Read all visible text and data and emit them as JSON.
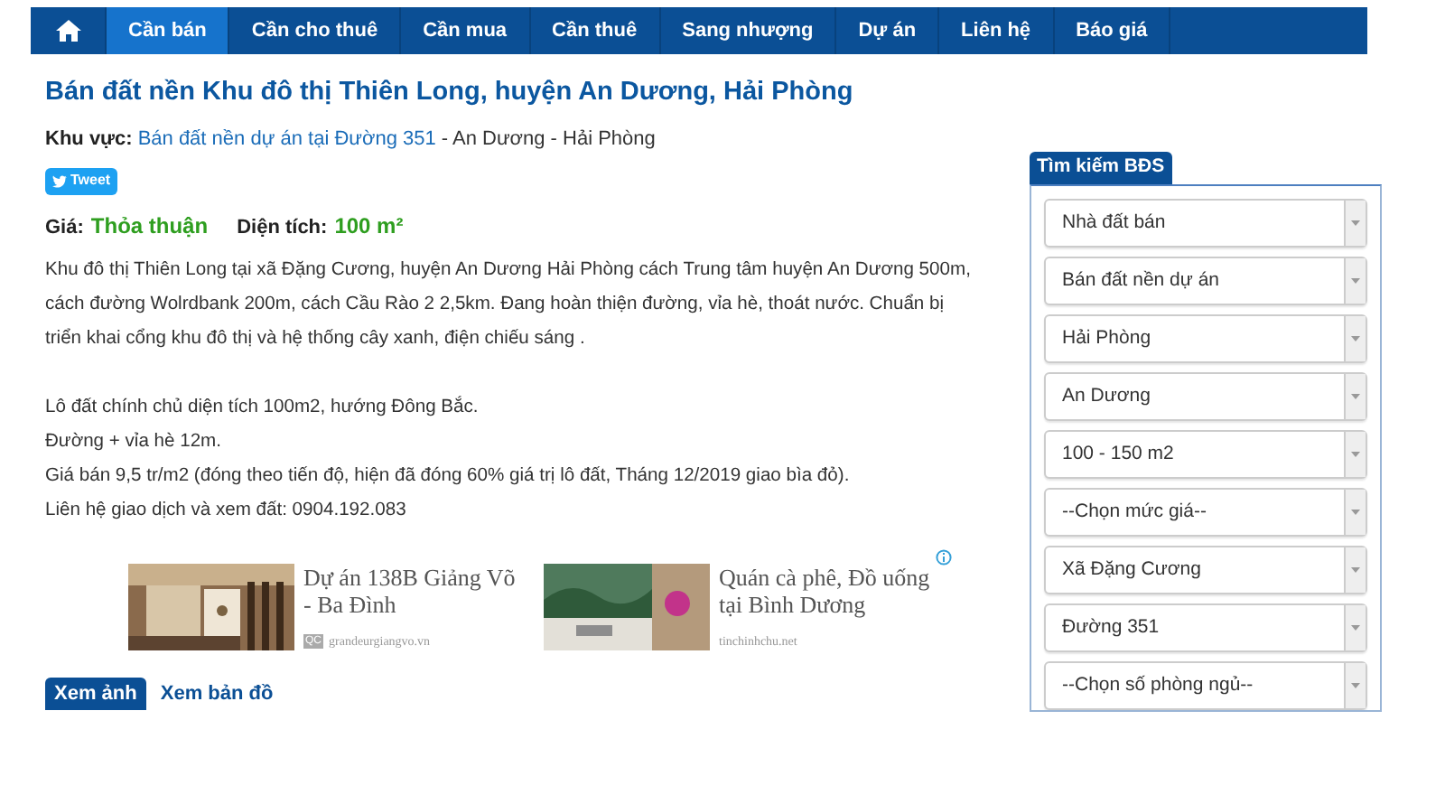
{
  "nav": [
    {
      "kind": "home",
      "selected": false
    },
    {
      "kind": "link",
      "label": "Cần bán",
      "selected": true
    },
    {
      "kind": "link",
      "label": "Cần cho thuê",
      "selected": false
    },
    {
      "kind": "link",
      "label": "Cần mua",
      "selected": false
    },
    {
      "kind": "link",
      "label": "Cần thuê",
      "selected": false
    },
    {
      "kind": "link",
      "label": "Sang nhượng",
      "selected": false
    },
    {
      "kind": "link",
      "label": "Dự án",
      "selected": false
    },
    {
      "kind": "link",
      "label": "Liên hệ",
      "selected": false
    },
    {
      "kind": "link",
      "label": "Báo giá",
      "selected": false
    }
  ],
  "title": "Bán đất nền Khu đô thị Thiên Long, huyện An Dương, Hải Phòng",
  "area": {
    "label": "Khu vực:",
    "link": "Bán đất nền dự án tại Đường 351",
    "rest": "- An Dương - Hải Phòng"
  },
  "tweet_button": "Tweet",
  "price": {
    "label": "Giá:",
    "value": "Thỏa thuận"
  },
  "size": {
    "label": "Diện tích:",
    "value": "100 m²"
  },
  "description": [
    [
      "Khu đô thị Thiên Long tại xã Đặng Cương, huyện An Dương Hải Phòng cách Trung tâm huyện An Dương 500m, cách đường Wolrdbank 200m, cách Cầu Rào 2 2,5km. Đang hoàn thiện đường, vỉa hè, thoát nước. Chuẩn bị triển khai cổng khu đô thị và hệ thống cây xanh, điện chiếu sáng ."
    ],
    [
      "Lô đất chính chủ diện tích 100m2, hướng Đông Bắc.",
      "Đường + vỉa hè 12m.",
      "Giá bán 9,5 tr/m2 (đóng theo tiến độ, hiện đã đóng 60% giá trị lô đất, Tháng 12/2019 giao bìa đỏ).",
      "Liên hệ giao dịch và xem đất: 0904.192.083"
    ]
  ],
  "ads": [
    {
      "title": "Dự án 138B Giảng Võ - Ba Đình",
      "badge": "QC",
      "source": "grandeurgiangvo.vn",
      "kind": "interior"
    },
    {
      "title": "Quán cà phê, Đồ uống tại Bình Dương",
      "source": "tinchinhchu.net",
      "kind": "garden"
    }
  ],
  "tabs": [
    {
      "label": "Xem ảnh",
      "selected": true
    },
    {
      "label": "Xem bản đồ",
      "selected": false
    }
  ],
  "search": {
    "title": "Tìm kiếm BĐS",
    "selects": [
      "Nhà đất bán",
      "Bán đất nền dự án",
      "Hải Phòng",
      "An Dương",
      "100 - 150 m2",
      "--Chọn mức giá--",
      "Xã Đặng Cương",
      "Đường 351",
      "--Chọn số phòng ngủ--"
    ]
  }
}
